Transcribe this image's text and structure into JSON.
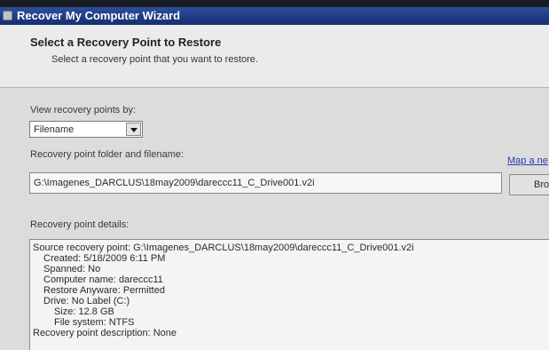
{
  "window": {
    "title": "Recover My Computer Wizard"
  },
  "header": {
    "title": "Select a Recovery Point to Restore",
    "subtitle": "Select a recovery point that you want to restore."
  },
  "view_by": {
    "label": "View recovery points by:",
    "selected": "Filename"
  },
  "folder": {
    "label": "Recovery point folder and filename:",
    "value": "G:\\Imagenes_DARCLUS\\18may2009\\dareccc11_C_Drive001.v2i",
    "map_link": "Map a ne",
    "browse_label": "Bro"
  },
  "details": {
    "label": "Recovery point details:",
    "lines": [
      "Source recovery point:  G:\\Imagenes_DARCLUS\\18may2009\\dareccc11_C_Drive001.v2i",
      "Created:  5/18/2009 6:11 PM",
      "Spanned:  No",
      "Computer name:  dareccc11",
      "Restore Anyware:  Permitted",
      "Drive:  No Label (C:)",
      "Size:  12.8 GB",
      "File system:  NTFS",
      "Recovery point description:  None"
    ]
  }
}
